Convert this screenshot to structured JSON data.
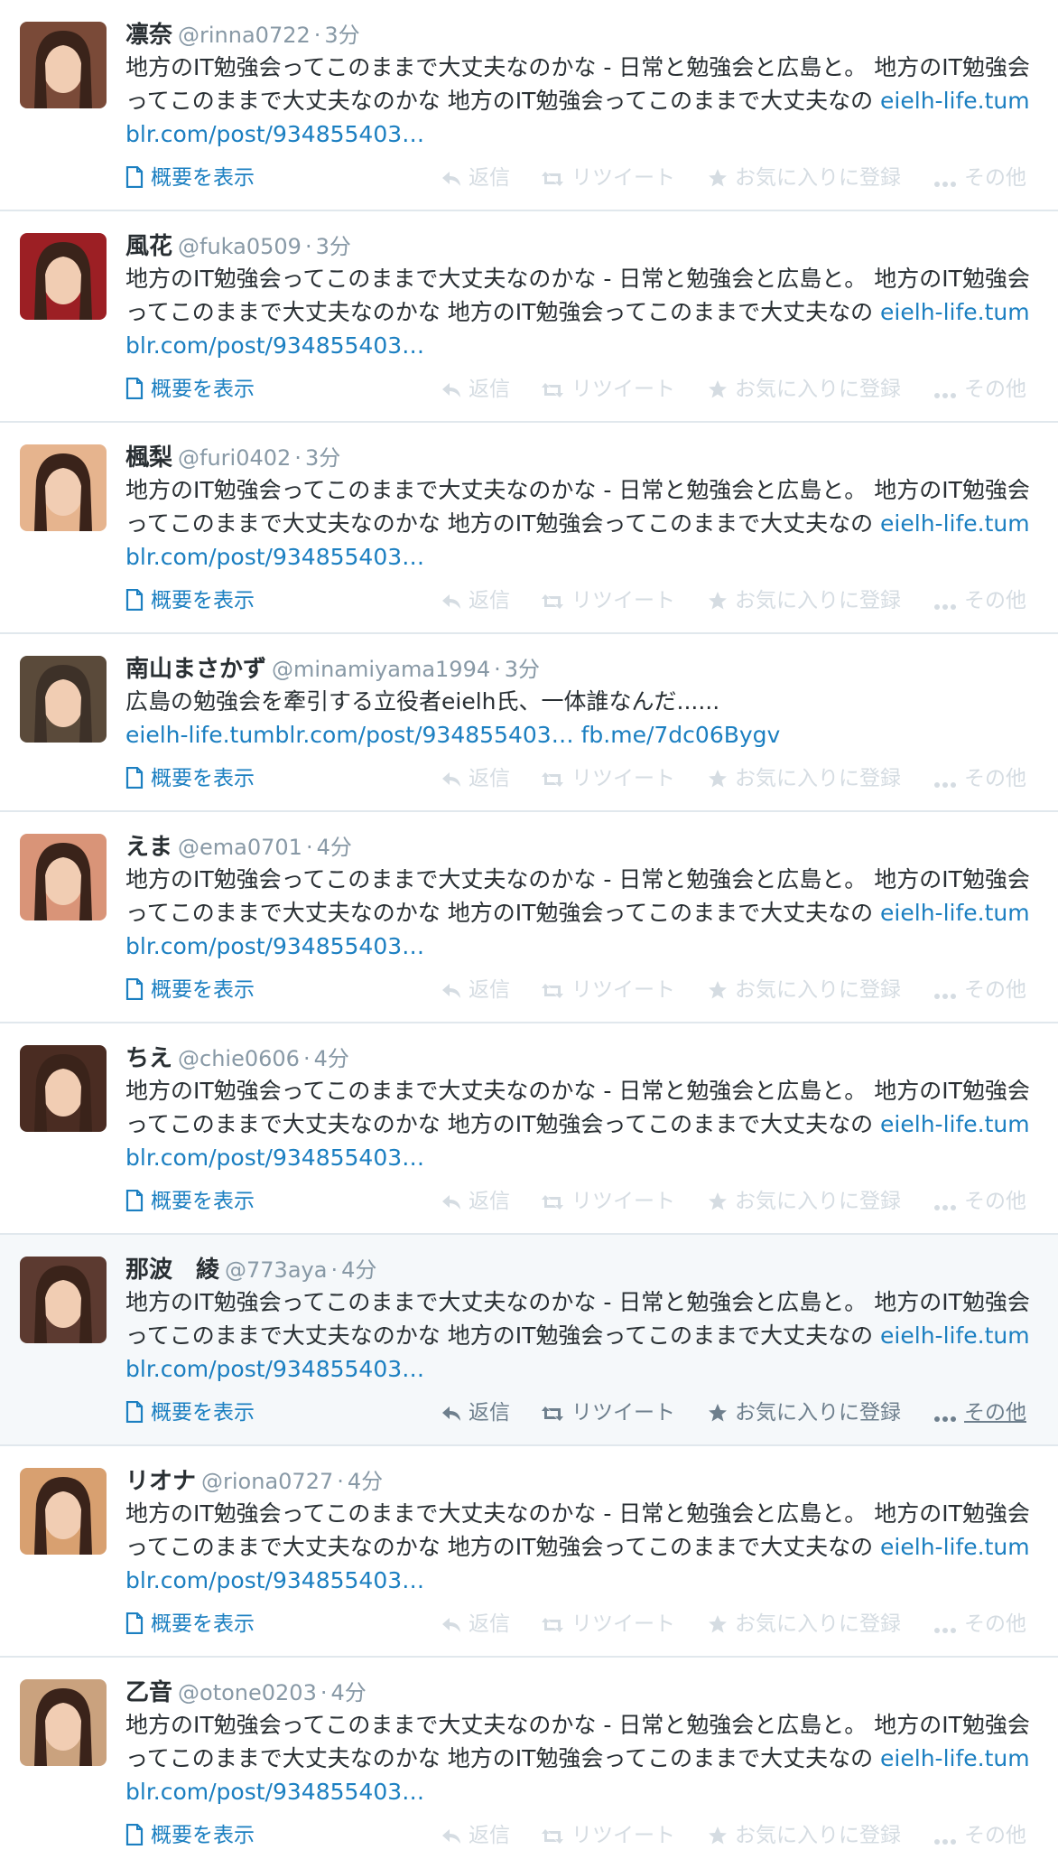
{
  "colors": {
    "link": "#1b7fc1",
    "muted": "#8899a6",
    "action_faded": "#d5dce2",
    "action_active": "#6e7f8d",
    "hover_bg": "#f5f8fa",
    "divider": "#e1e8ed"
  },
  "icons": {
    "summary": "document-icon",
    "reply": "reply-arrow-icon",
    "retweet": "retweet-icon",
    "favorite": "star-icon",
    "more": "ellipsis-icon"
  },
  "actions": {
    "summary_label": "概要を表示",
    "reply_label": "返信",
    "retweet_label": "リツイート",
    "favorite_label": "お気に入りに登録",
    "more_label": "その他"
  },
  "tweets": [
    {
      "name": "凛奈",
      "handle": "@rinna0722",
      "time": "3分",
      "text": "地方のIT勉強会ってこのままで大丈夫なのかな - 日常と勉強会と広島と。 地方のIT勉強会ってこのままで大丈夫なのかな 地方のIT勉強会ってこのままで大丈夫なの ",
      "links": [
        "eielh-life.tumblr.com/post/934855403…"
      ],
      "avatar_color": "#7a4a38",
      "hovered": false
    },
    {
      "name": "風花",
      "handle": "@fuka0509",
      "time": "3分",
      "text": "地方のIT勉強会ってこのままで大丈夫なのかな - 日常と勉強会と広島と。 地方のIT勉強会ってこのままで大丈夫なのかな 地方のIT勉強会ってこのままで大丈夫なの ",
      "links": [
        "eielh-life.tumblr.com/post/934855403…"
      ],
      "avatar_color": "#9c1f24",
      "hovered": false
    },
    {
      "name": "楓梨",
      "handle": "@furi0402",
      "time": "3分",
      "text": "地方のIT勉強会ってこのままで大丈夫なのかな - 日常と勉強会と広島と。 地方のIT勉強会ってこのままで大丈夫なのかな 地方のIT勉強会ってこのままで大丈夫なの ",
      "links": [
        "eielh-life.tumblr.com/post/934855403…"
      ],
      "avatar_color": "#e6b48e",
      "hovered": false
    },
    {
      "name": "南山まさかず",
      "handle": "@minamiyama1994",
      "time": "3分",
      "text": "広島の勉強会を牽引する立役者eielh氏、一体誰なんだ......\n",
      "links": [
        "eielh-life.tumblr.com/post/934855403…",
        "fb.me/7dc06Bygv"
      ],
      "avatar_color": "#5a4a3a",
      "hovered": false
    },
    {
      "name": "えま",
      "handle": "@ema0701",
      "time": "4分",
      "text": "地方のIT勉強会ってこのままで大丈夫なのかな - 日常と勉強会と広島と。 地方のIT勉強会ってこのままで大丈夫なのかな 地方のIT勉強会ってこのままで大丈夫なの ",
      "links": [
        "eielh-life.tumblr.com/post/934855403…"
      ],
      "avatar_color": "#d99478",
      "hovered": false
    },
    {
      "name": "ちえ",
      "handle": "@chie0606",
      "time": "4分",
      "text": "地方のIT勉強会ってこのままで大丈夫なのかな - 日常と勉強会と広島と。 地方のIT勉強会ってこのままで大丈夫なのかな 地方のIT勉強会ってこのままで大丈夫なの ",
      "links": [
        "eielh-life.tumblr.com/post/934855403…"
      ],
      "avatar_color": "#4a2c22",
      "hovered": false
    },
    {
      "name": "那波　綾",
      "handle": "@773aya",
      "time": "4分",
      "text": "地方のIT勉強会ってこのままで大丈夫なのかな - 日常と勉強会と広島と。 地方のIT勉強会ってこのままで大丈夫なのかな 地方のIT勉強会ってこのままで大丈夫なの ",
      "links": [
        "eielh-life.tumblr.com/post/934855403…"
      ],
      "avatar_color": "#5c3a30",
      "hovered": true
    },
    {
      "name": "リオナ",
      "handle": "@riona0727",
      "time": "4分",
      "text": "地方のIT勉強会ってこのままで大丈夫なのかな - 日常と勉強会と広島と。 地方のIT勉強会ってこのままで大丈夫なのかな 地方のIT勉強会ってこのままで大丈夫なの ",
      "links": [
        "eielh-life.tumblr.com/post/934855403…"
      ],
      "avatar_color": "#d8a070",
      "hovered": false
    },
    {
      "name": "乙音",
      "handle": "@otone0203",
      "time": "4分",
      "text": "地方のIT勉強会ってこのままで大丈夫なのかな - 日常と勉強会と広島と。 地方のIT勉強会ってこのままで大丈夫なのかな 地方のIT勉強会ってこのままで大丈夫なの ",
      "links": [
        "eielh-life.tumblr.com/post/934855403…"
      ],
      "avatar_color": "#caa27e",
      "hovered": false
    }
  ]
}
